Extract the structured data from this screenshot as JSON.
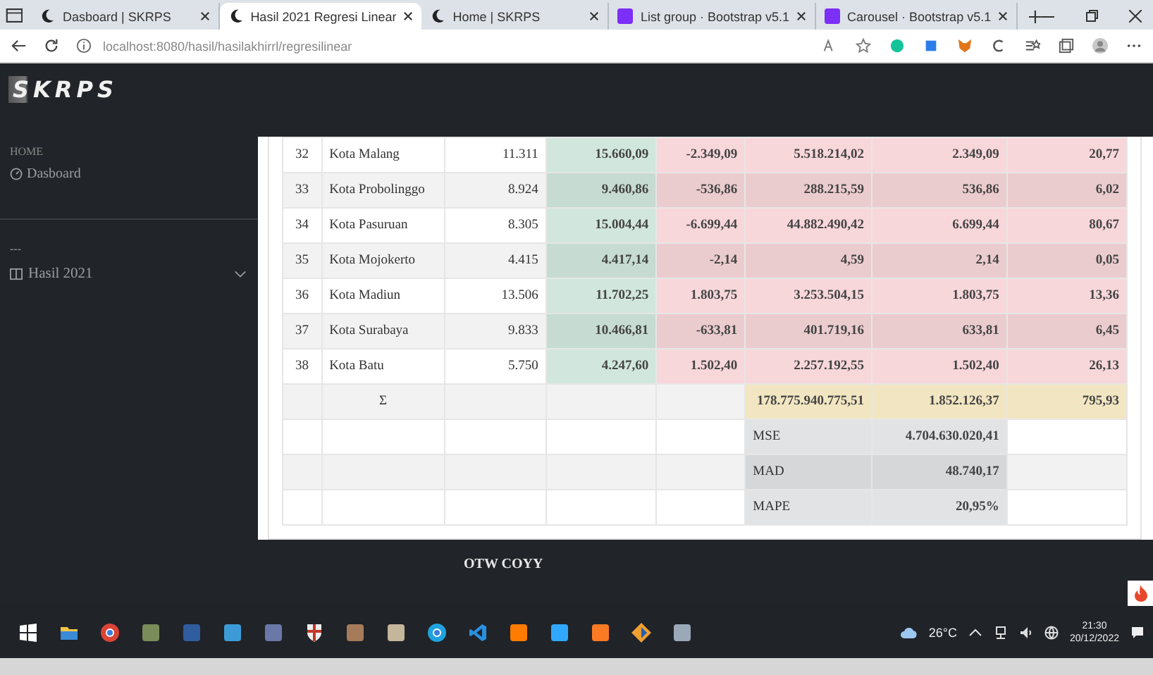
{
  "browser": {
    "tabs": [
      {
        "title": "Dasboard | SKRPS",
        "selected": false,
        "kind": "moon"
      },
      {
        "title": "Hasil 2021 Regresi Linear",
        "selected": true,
        "kind": "moon"
      },
      {
        "title": "Home | SKRPS",
        "selected": false,
        "kind": "moon"
      },
      {
        "title": "List group · Bootstrap v5.1",
        "selected": false,
        "kind": "bootstrap"
      },
      {
        "title": "Carousel · Bootstrap v5.1",
        "selected": false,
        "kind": "bootstrap"
      }
    ],
    "url": "localhost:8080/hasil/hasilakhirrl/regresilinear"
  },
  "app": {
    "brand": "SKRPS",
    "sidebar": {
      "heading": "HOME",
      "items": [
        {
          "label": "Dasboard",
          "kind": "gauge"
        }
      ],
      "separator": "---",
      "groups": [
        {
          "label": "Hasil 2021",
          "expanded": false
        }
      ]
    },
    "table": {
      "rows": [
        {
          "cells": [
            {
              "text": "32",
              "kind": "plain"
            },
            {
              "text": "Kota Malang",
              "kind": "plain"
            },
            {
              "text": "11.311",
              "kind": "plain"
            },
            {
              "text": "15.660,09",
              "kind": "success"
            },
            {
              "text": "-2.349,09",
              "kind": "danger"
            },
            {
              "text": "5.518.214,02",
              "kind": "danger"
            },
            {
              "text": "2.349,09",
              "kind": "danger"
            },
            {
              "text": "20,77",
              "kind": "danger"
            }
          ]
        },
        {
          "cells": [
            {
              "text": "33",
              "kind": "plain"
            },
            {
              "text": "Kota Probolinggo",
              "kind": "plain"
            },
            {
              "text": "8.924",
              "kind": "plain"
            },
            {
              "text": "9.460,86",
              "kind": "success"
            },
            {
              "text": "-536,86",
              "kind": "danger"
            },
            {
              "text": "288.215,59",
              "kind": "danger"
            },
            {
              "text": "536,86",
              "kind": "danger"
            },
            {
              "text": "6,02",
              "kind": "danger"
            }
          ]
        },
        {
          "cells": [
            {
              "text": "34",
              "kind": "plain"
            },
            {
              "text": "Kota Pasuruan",
              "kind": "plain"
            },
            {
              "text": "8.305",
              "kind": "plain"
            },
            {
              "text": "15.004,44",
              "kind": "success"
            },
            {
              "text": "-6.699,44",
              "kind": "danger"
            },
            {
              "text": "44.882.490,42",
              "kind": "danger"
            },
            {
              "text": "6.699,44",
              "kind": "danger"
            },
            {
              "text": "80,67",
              "kind": "danger"
            }
          ]
        },
        {
          "cells": [
            {
              "text": "35",
              "kind": "plain"
            },
            {
              "text": "Kota Mojokerto",
              "kind": "plain"
            },
            {
              "text": "4.415",
              "kind": "plain"
            },
            {
              "text": "4.417,14",
              "kind": "success"
            },
            {
              "text": "-2,14",
              "kind": "danger"
            },
            {
              "text": "4,59",
              "kind": "danger"
            },
            {
              "text": "2,14",
              "kind": "danger"
            },
            {
              "text": "0,05",
              "kind": "danger"
            }
          ]
        },
        {
          "cells": [
            {
              "text": "36",
              "kind": "plain"
            },
            {
              "text": "Kota Madiun",
              "kind": "plain"
            },
            {
              "text": "13.506",
              "kind": "plain"
            },
            {
              "text": "11.702,25",
              "kind": "success"
            },
            {
              "text": "1.803,75",
              "kind": "danger"
            },
            {
              "text": "3.253.504,15",
              "kind": "danger"
            },
            {
              "text": "1.803,75",
              "kind": "danger"
            },
            {
              "text": "13,36",
              "kind": "danger"
            }
          ]
        },
        {
          "cells": [
            {
              "text": "37",
              "kind": "plain"
            },
            {
              "text": "Kota Surabaya",
              "kind": "plain"
            },
            {
              "text": "9.833",
              "kind": "plain"
            },
            {
              "text": "10.466,81",
              "kind": "success"
            },
            {
              "text": "-633,81",
              "kind": "danger"
            },
            {
              "text": "401.719,16",
              "kind": "danger"
            },
            {
              "text": "633,81",
              "kind": "danger"
            },
            {
              "text": "6,45",
              "kind": "danger"
            }
          ]
        },
        {
          "cells": [
            {
              "text": "38",
              "kind": "plain"
            },
            {
              "text": "Kota Batu",
              "kind": "plain"
            },
            {
              "text": "5.750",
              "kind": "plain"
            },
            {
              "text": "4.247,60",
              "kind": "success"
            },
            {
              "text": "1.502,40",
              "kind": "danger"
            },
            {
              "text": "2.257.192,55",
              "kind": "danger"
            },
            {
              "text": "1.502,40",
              "kind": "danger"
            },
            {
              "text": "26,13",
              "kind": "danger"
            }
          ]
        },
        {
          "cells": [
            {
              "kind": "plain"
            },
            {
              "text": "Σ",
              "kind": "symbol"
            },
            {
              "kind": "plain"
            },
            {
              "kind": "plain"
            },
            {
              "kind": "plain"
            },
            {
              "text": "178.775.940.775,51",
              "kind": "warning"
            },
            {
              "text": "1.852.126,37",
              "kind": "warning"
            },
            {
              "text": "795,93",
              "kind": "warning"
            }
          ]
        },
        {
          "cells": [
            {
              "kind": "plain"
            },
            {
              "kind": "plain"
            },
            {
              "kind": "plain"
            },
            {
              "kind": "plain"
            },
            {
              "kind": "plain"
            },
            {
              "text": "MSE",
              "kind": "metric"
            },
            {
              "text": "4.704.630.020,41",
              "kind": "secondary"
            },
            {
              "kind": "plain"
            }
          ]
        },
        {
          "cells": [
            {
              "kind": "plain"
            },
            {
              "kind": "plain"
            },
            {
              "kind": "plain"
            },
            {
              "kind": "plain"
            },
            {
              "kind": "plain"
            },
            {
              "text": "MAD",
              "kind": "metric"
            },
            {
              "text": "48.740,17",
              "kind": "secondary"
            },
            {
              "kind": "plain"
            }
          ]
        },
        {
          "cells": [
            {
              "kind": "plain"
            },
            {
              "kind": "plain"
            },
            {
              "kind": "plain"
            },
            {
              "kind": "plain"
            },
            {
              "kind": "plain"
            },
            {
              "text": "MAPE",
              "kind": "metric"
            },
            {
              "text": "20,95%",
              "kind": "secondary"
            },
            {
              "kind": "plain"
            }
          ]
        }
      ]
    },
    "footer": "OTW COYY"
  },
  "taskbar": {
    "weather": "26°C",
    "time": "21:30",
    "date": "20/12/2022"
  }
}
